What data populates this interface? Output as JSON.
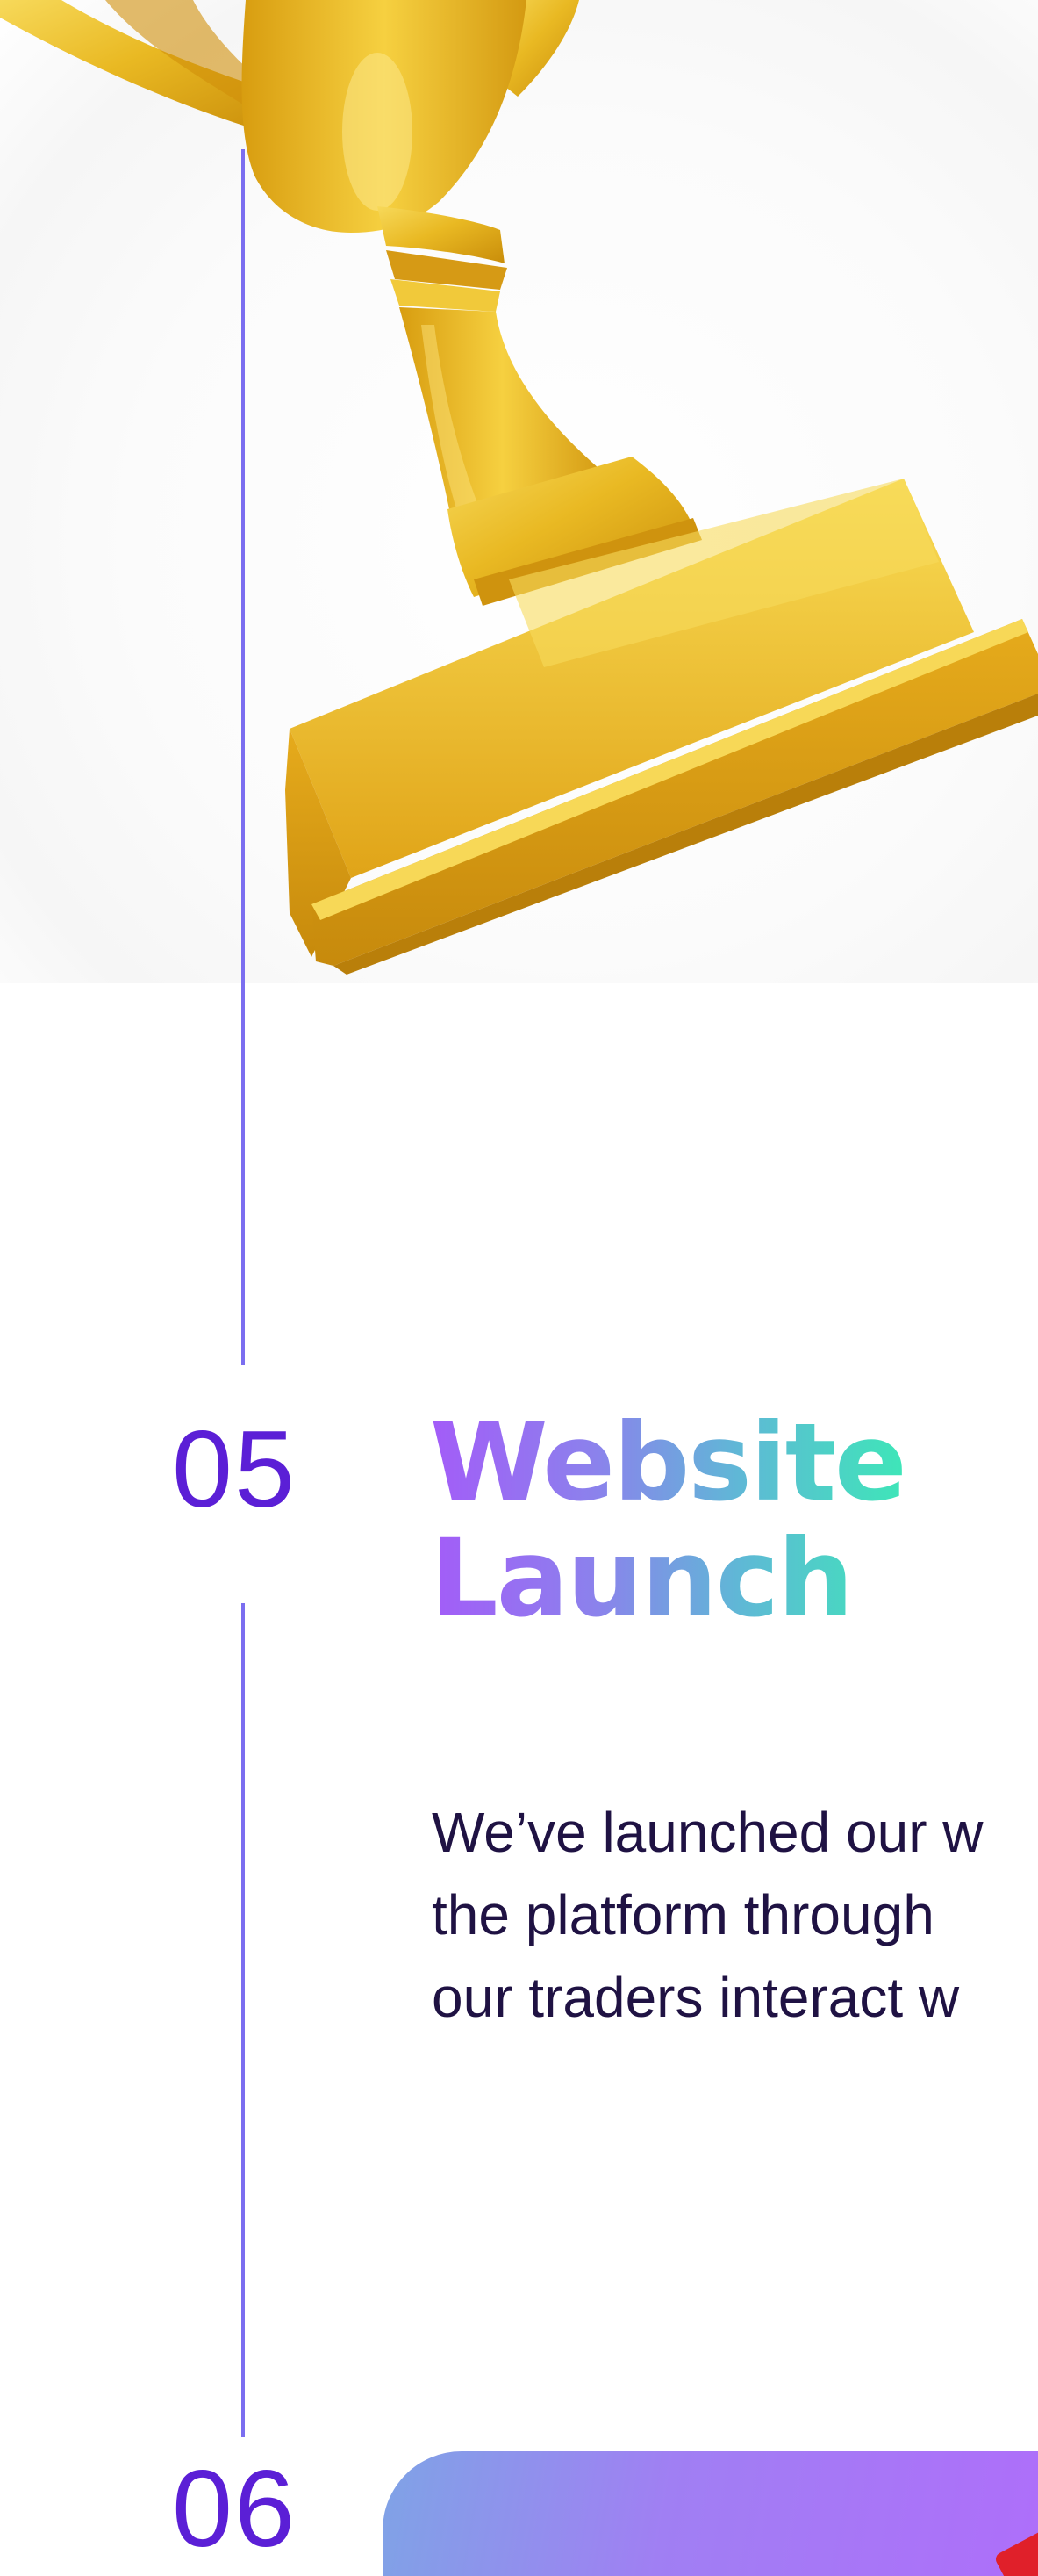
{
  "timeline": {
    "step5": {
      "number": "05",
      "title_line1": "Website",
      "title_line2": "Launch",
      "description_lines": [
        "We’ve launched our w",
        "the platform through",
        "our traders interact w"
      ]
    },
    "step6": {
      "number": "06"
    }
  },
  "colors": {
    "timeline_line": "#7b6ef0",
    "number": "#5b1fd6",
    "title_gradient_start": "#a35cf8",
    "title_gradient_end": "#3ee6b8",
    "body_text": "#1f1243",
    "trophy_gold": "#e8b923"
  },
  "illustrations": {
    "trophy": "gold-trophy-icon"
  }
}
